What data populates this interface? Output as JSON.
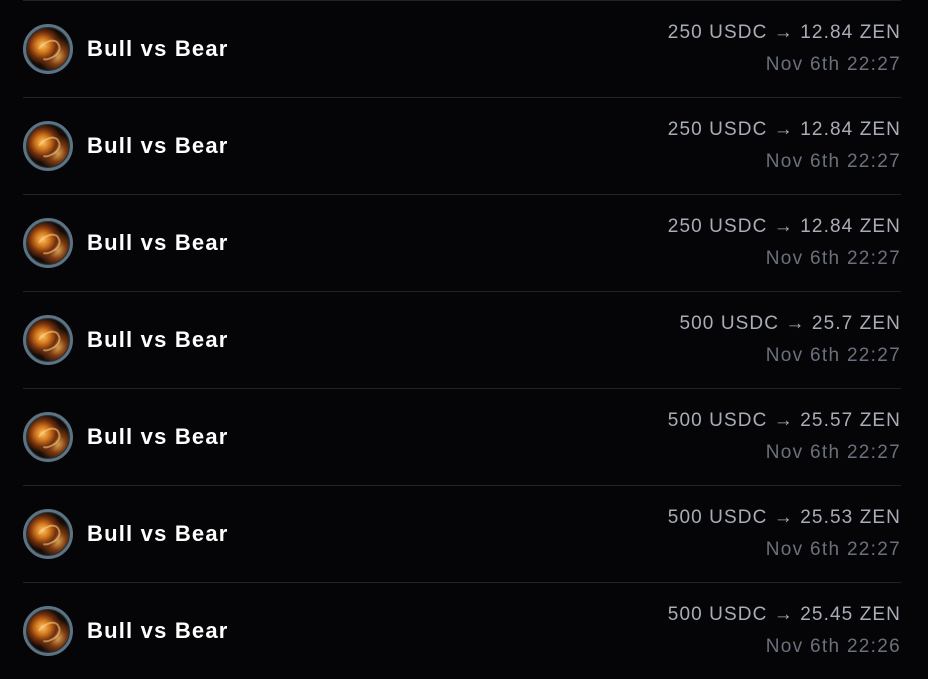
{
  "rows": [
    {
      "name": "Bull vs Bear",
      "trade": "250 USDC → 12.84 ZEN",
      "time": "Nov 6th 22:27"
    },
    {
      "name": "Bull vs Bear",
      "trade": "250 USDC → 12.84 ZEN",
      "time": "Nov 6th 22:27"
    },
    {
      "name": "Bull vs Bear",
      "trade": "250 USDC → 12.84 ZEN",
      "time": "Nov 6th 22:27"
    },
    {
      "name": "Bull vs Bear",
      "trade": "500 USDC → 25.7 ZEN",
      "time": "Nov 6th 22:27"
    },
    {
      "name": "Bull vs Bear",
      "trade": "500 USDC → 25.57 ZEN",
      "time": "Nov 6th 22:27"
    },
    {
      "name": "Bull vs Bear",
      "trade": "500 USDC → 25.53 ZEN",
      "time": "Nov 6th 22:27"
    },
    {
      "name": "Bull vs Bear",
      "trade": "500 USDC → 25.45 ZEN",
      "time": "Nov 6th 22:26"
    }
  ],
  "icon": "bull-vs-bear-avatar-icon"
}
